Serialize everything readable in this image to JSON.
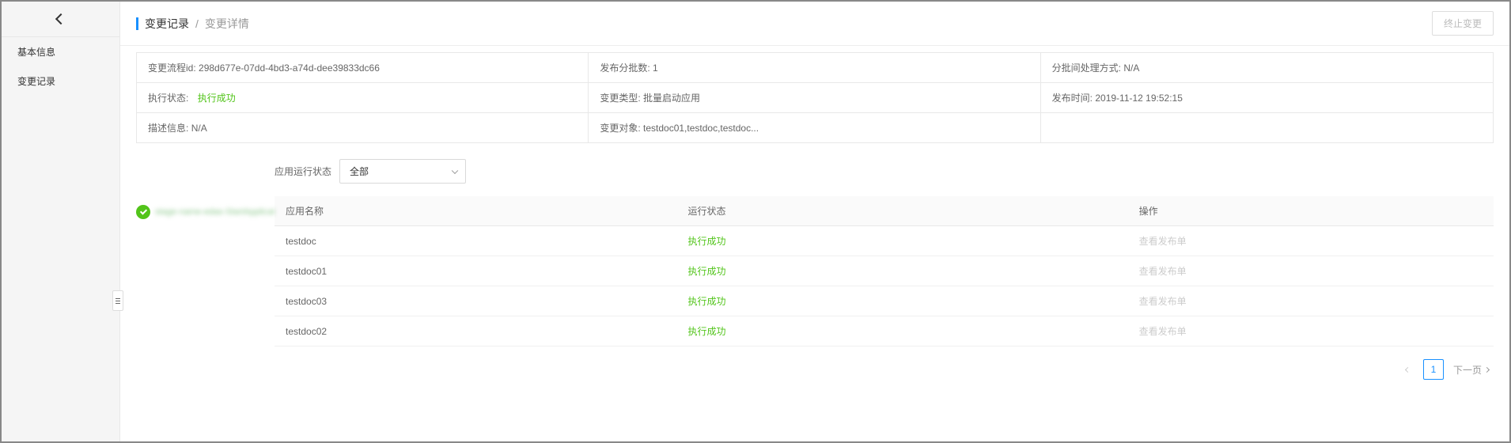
{
  "sidebar": {
    "items": [
      {
        "label": "基本信息"
      },
      {
        "label": "变更记录"
      }
    ]
  },
  "breadcrumb": {
    "root": "变更记录",
    "current": "变更详情"
  },
  "header": {
    "stop_button": "终止变更"
  },
  "info": {
    "flow_id_label": "变更流程id:",
    "flow_id_value": "298d677e-07dd-4bd3-a74d-dee39833dc66",
    "batch_count_label": "发布分批数:",
    "batch_count_value": "1",
    "batch_mode_label": "分批间处理方式:",
    "batch_mode_value": "N/A",
    "exec_status_label": "执行状态:",
    "exec_status_value": "执行成功",
    "change_type_label": "变更类型:",
    "change_type_value": "批量启动应用",
    "publish_time_label": "发布时间:",
    "publish_time_value": "2019-11-12 19:52:15",
    "desc_label": "描述信息:",
    "desc_value": "N/A",
    "target_label": "变更对象:",
    "target_value": "testdoc01,testdoc,testdoc..."
  },
  "filter": {
    "label": "应用运行状态",
    "selected": "全部"
  },
  "stage": {
    "text": "stage-name-edas-StartApplicat..."
  },
  "table": {
    "columns": {
      "name": "应用名称",
      "status": "运行状态",
      "action": "操作"
    },
    "rows": [
      {
        "name": "testdoc",
        "status": "执行成功",
        "action": "查看发布单"
      },
      {
        "name": "testdoc01",
        "status": "执行成功",
        "action": "查看发布单"
      },
      {
        "name": "testdoc03",
        "status": "执行成功",
        "action": "查看发布单"
      },
      {
        "name": "testdoc02",
        "status": "执行成功",
        "action": "查看发布单"
      }
    ]
  },
  "pagination": {
    "current": "1",
    "next_label": "下一页"
  },
  "colors": {
    "success": "#52c41a",
    "primary": "#1890ff"
  }
}
